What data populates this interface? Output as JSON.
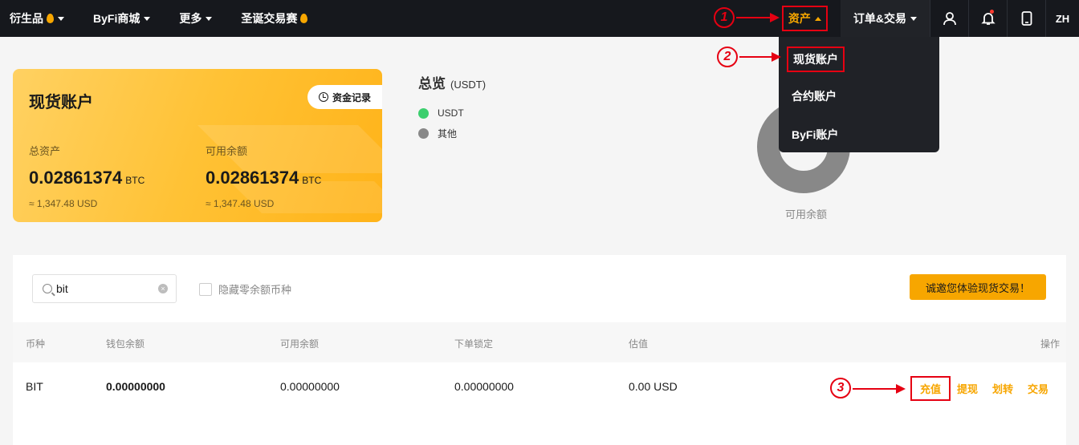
{
  "nav": {
    "items": [
      {
        "label": "衍生品",
        "flame": true,
        "caret": true
      },
      {
        "label": "ByFi商城",
        "flame": false,
        "caret": true
      },
      {
        "label": "更多",
        "flame": false,
        "caret": true
      },
      {
        "label": "圣诞交易赛",
        "flame": true,
        "caret": false
      }
    ],
    "assets_label": "资产",
    "orders_label": "订单&交易",
    "lang_label": "ZH"
  },
  "dropdown": {
    "items": [
      "现货账户",
      "合约账户",
      "ByFi账户"
    ]
  },
  "card": {
    "title": "现货账户",
    "record_label": "资金记录",
    "total_label": "总资产",
    "total_value": "0.02861374",
    "total_unit": "BTC",
    "total_usd": "≈ 1,347.48 USD",
    "available_label": "可用余额",
    "available_value": "0.02861374",
    "available_unit": "BTC",
    "available_usd": "≈ 1,347.48 USD"
  },
  "overview": {
    "title": "总览",
    "unit": "(USDT)",
    "legend": [
      {
        "label": "USDT",
        "color": "#3ccf6e"
      },
      {
        "label": "其他",
        "color": "#888888"
      }
    ],
    "donut_label": "可用余额"
  },
  "panel": {
    "search_value": "bit",
    "hide_zero_label": "隐藏零余额币种",
    "invite_label": "诚邀您体验现货交易！",
    "columns": [
      "币种",
      "钱包余额",
      "可用余额",
      "下单锁定",
      "估值",
      "操作"
    ],
    "rows": [
      {
        "coin": "BIT",
        "wallet": "0.00000000",
        "available": "0.00000000",
        "locked": "0.00000000",
        "value": "0.00 USD"
      }
    ],
    "actions": [
      "充值",
      "提现",
      "划转",
      "交易"
    ]
  },
  "annotations": [
    "1",
    "2",
    "3"
  ],
  "colors": {
    "accent": "#f7a600",
    "nav_bg": "#16181d",
    "highlight": "#e60012"
  }
}
